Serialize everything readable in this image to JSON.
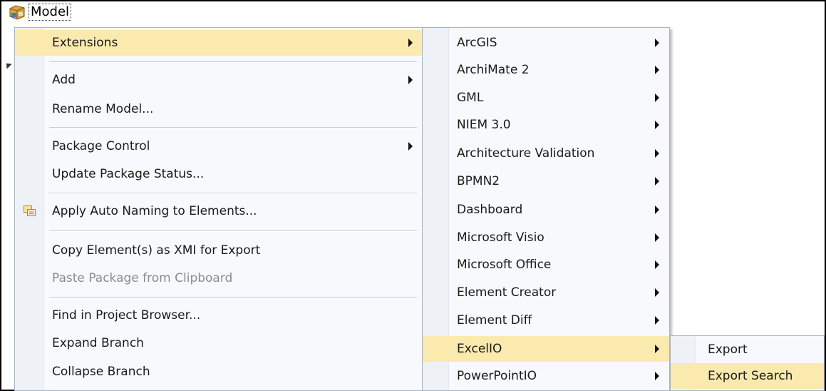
{
  "tree": {
    "node_label": "Model",
    "node_icon": "package-icon"
  },
  "main_menu": {
    "items": [
      {
        "label": "Extensions",
        "submenu": true
      },
      {
        "label": "Add",
        "submenu": true
      },
      {
        "label": "Rename Model..."
      },
      {
        "label": "Package Control",
        "submenu": true
      },
      {
        "label": "Update Package Status..."
      },
      {
        "label": "Apply Auto Naming to Elements...",
        "icon": "auto-naming-icon"
      },
      {
        "label": "Copy Element(s) as XMI for Export"
      },
      {
        "label": "Paste Package from Clipboard",
        "disabled": true
      },
      {
        "label": "Find in Project Browser..."
      },
      {
        "label": "Expand Branch"
      },
      {
        "label": "Collapse Branch"
      }
    ]
  },
  "extensions_menu": {
    "items": [
      {
        "label": "ArcGIS"
      },
      {
        "label": "ArchiMate 2"
      },
      {
        "label": "GML"
      },
      {
        "label": "NIEM 3.0"
      },
      {
        "label": "Architecture Validation"
      },
      {
        "label": "BPMN2"
      },
      {
        "label": "Dashboard"
      },
      {
        "label": "Microsoft Visio"
      },
      {
        "label": "Microsoft Office"
      },
      {
        "label": "Element Creator"
      },
      {
        "label": "Element Diff"
      },
      {
        "label": "ExcelIO"
      },
      {
        "label": "PowerPointIO"
      }
    ]
  },
  "excelio_menu": {
    "items": [
      {
        "label": "Export"
      },
      {
        "label": "Export Search"
      }
    ]
  },
  "colors": {
    "highlight": "#fbeaad",
    "menu_bg": "#f7f9fc",
    "disabled_text": "#8b8b8b"
  }
}
